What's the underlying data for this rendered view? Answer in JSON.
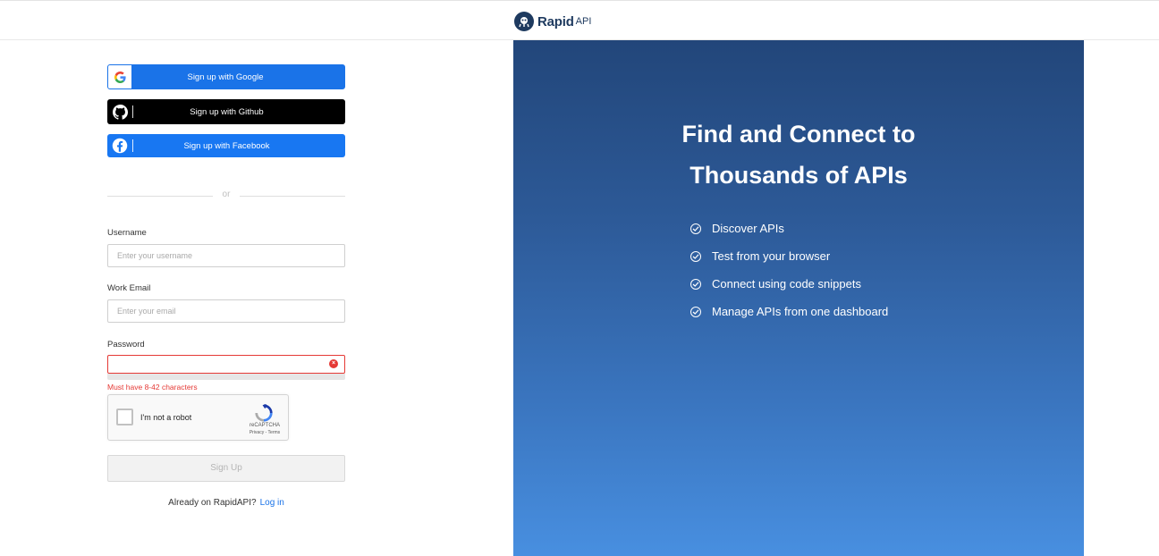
{
  "brand": {
    "name": "Rapid",
    "suffix": "API"
  },
  "social": {
    "google": "Sign up with Google",
    "github": "Sign up with Github",
    "facebook": "Sign up with Facebook"
  },
  "divider": "or",
  "form": {
    "username_label": "Username",
    "username_placeholder": "Enter your username",
    "email_label": "Work Email",
    "email_placeholder": "Enter your email",
    "password_label": "Password",
    "password_error": "Must have 8-42 characters",
    "signup_button": "Sign Up"
  },
  "recaptcha": {
    "label": "I'm not a robot",
    "brand": "reCAPTCHA",
    "links": "Privacy - Terms"
  },
  "login": {
    "prompt": "Already on RapidAPI?",
    "link": "Log in"
  },
  "hero": {
    "title_line1": "Find and Connect to",
    "title_line2": "Thousands of APIs",
    "features": [
      "Discover APIs",
      "Test from your browser",
      "Connect using code snippets",
      "Manage APIs from one dashboard"
    ]
  },
  "colors": {
    "brand_navy": "#1e3a5f",
    "google_blue": "#1a73e8",
    "facebook_blue": "#1877f2",
    "error_red": "#e53935",
    "hero_top": "#22467a",
    "hero_bottom": "#488fe0"
  }
}
